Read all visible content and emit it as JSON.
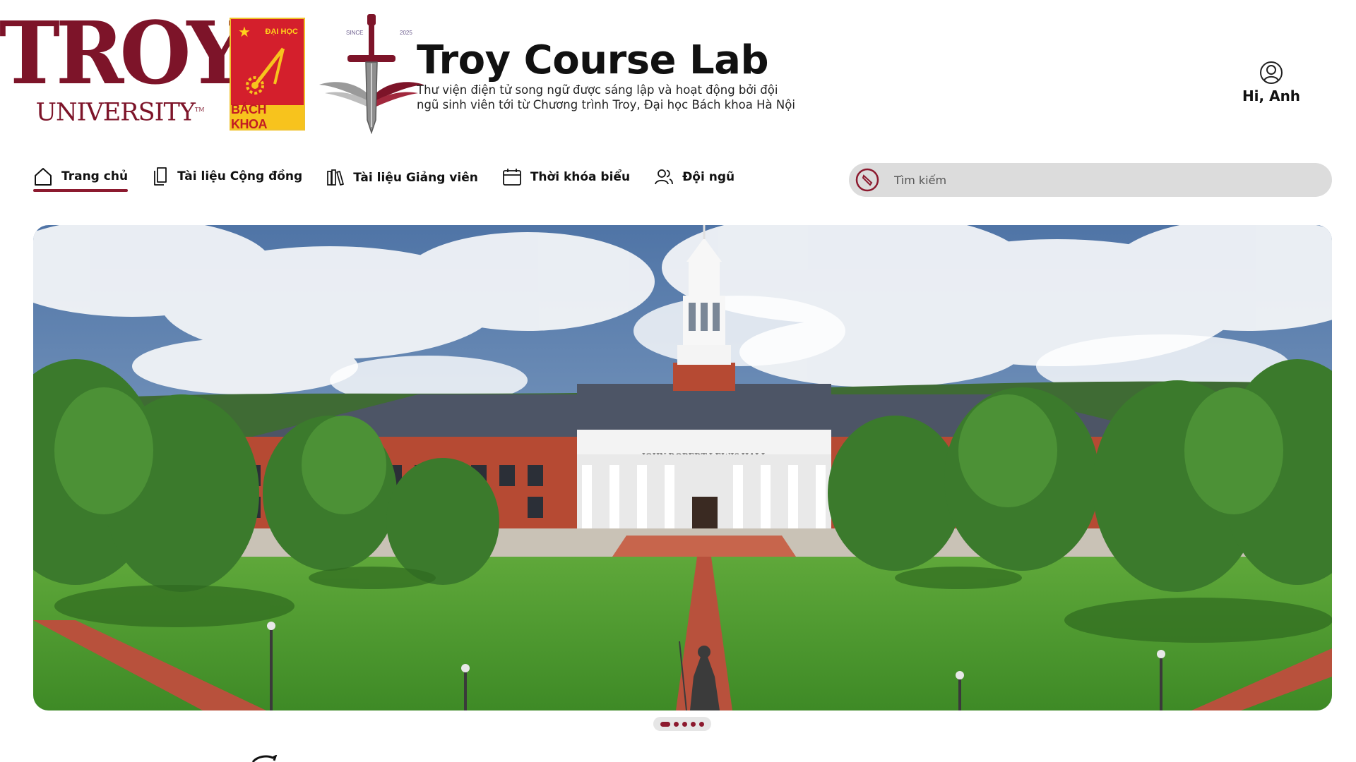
{
  "logos": {
    "troy_word": "TROY",
    "troy_university": "UNIVERSITY",
    "troy_tm": "TM",
    "bk_top": "ĐẠI HỌC",
    "bk_bottom": "BÁCH KHOA",
    "sword_since": "SINCE",
    "sword_year": "2025"
  },
  "brand": {
    "title": "Troy Course Lab",
    "subtitle": "Thư viện điện tử song ngữ được sáng lập và hoạt động bởi đội ngũ sinh viên tới từ Chương trình Troy, Đại học Bách khoa Hà Nội"
  },
  "user": {
    "greeting": "Hi, Anh",
    "icon": "user-circle-icon"
  },
  "nav": {
    "items": [
      {
        "label": "Trang chủ",
        "icon": "home-icon",
        "active": true
      },
      {
        "label": "Tài liệu Cộng đồng",
        "icon": "documents-icon",
        "active": false
      },
      {
        "label": "Tài liệu Giảng viên",
        "icon": "library-icon",
        "active": false
      },
      {
        "label": "Thời khóa biểu",
        "icon": "calendar-icon",
        "active": false
      },
      {
        "label": "Đội ngũ",
        "icon": "team-icon",
        "active": false
      }
    ]
  },
  "search": {
    "placeholder": "Tìm kiếm",
    "value": ""
  },
  "hero": {
    "building_sign": "JOHN ROBERT LEWIS HALL",
    "slides_total": 5,
    "current_slide": 1
  },
  "colors": {
    "brand": "#8c1a2f",
    "troy_maroon": "#7d1429",
    "search_bg": "#dcdcdc"
  }
}
